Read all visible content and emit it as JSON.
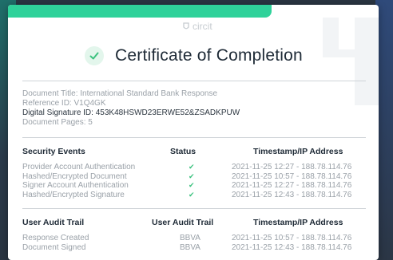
{
  "brand": {
    "name": "circit"
  },
  "title": "Certificate of Completion",
  "meta": {
    "document_title": "Document Title: International Standard Bank Response",
    "reference_id": "Reference ID: V1Q4GK",
    "digital_signature": "Digital Signature ID: 453K48HSWD23ERWE52&ZSADKPUW",
    "pages": "Document Pages: 5"
  },
  "security": {
    "headers": [
      "Security Events",
      "Status",
      "Timestamp/IP Address"
    ],
    "rows": [
      {
        "event": "Provider Account Authentication",
        "status": "✔",
        "timestamp": "2021-11-25 12:27 - 188.78.114.76"
      },
      {
        "event": "Hashed/Encrypted Document",
        "status": "✔",
        "timestamp": "2021-11-25 10:57 - 188.78.114.76"
      },
      {
        "event": "Signer Account Authentication",
        "status": "✔",
        "timestamp": "2021-11-25 12:27 - 188.78.114.76"
      },
      {
        "event": "Hashed/Encrypted Signature",
        "status": "✔",
        "timestamp": "2021-11-25 12:43 - 188.78.114.76"
      }
    ]
  },
  "audit": {
    "headers": [
      "User Audit Trail",
      "User Audit Trail",
      "Timestamp/IP Address"
    ],
    "rows": [
      {
        "event": "Response Created",
        "user": "BBVA",
        "timestamp": "2021-11-25 10:57 - 188.78.114.76"
      },
      {
        "event": "Document Signed",
        "user": "BBVA",
        "timestamp": "2021-11-25 12:43 - 188.78.114.76"
      }
    ]
  },
  "colors": {
    "accent_green": "#2fd29a",
    "check_green": "#3cc27f",
    "title": "#1e2a36"
  }
}
